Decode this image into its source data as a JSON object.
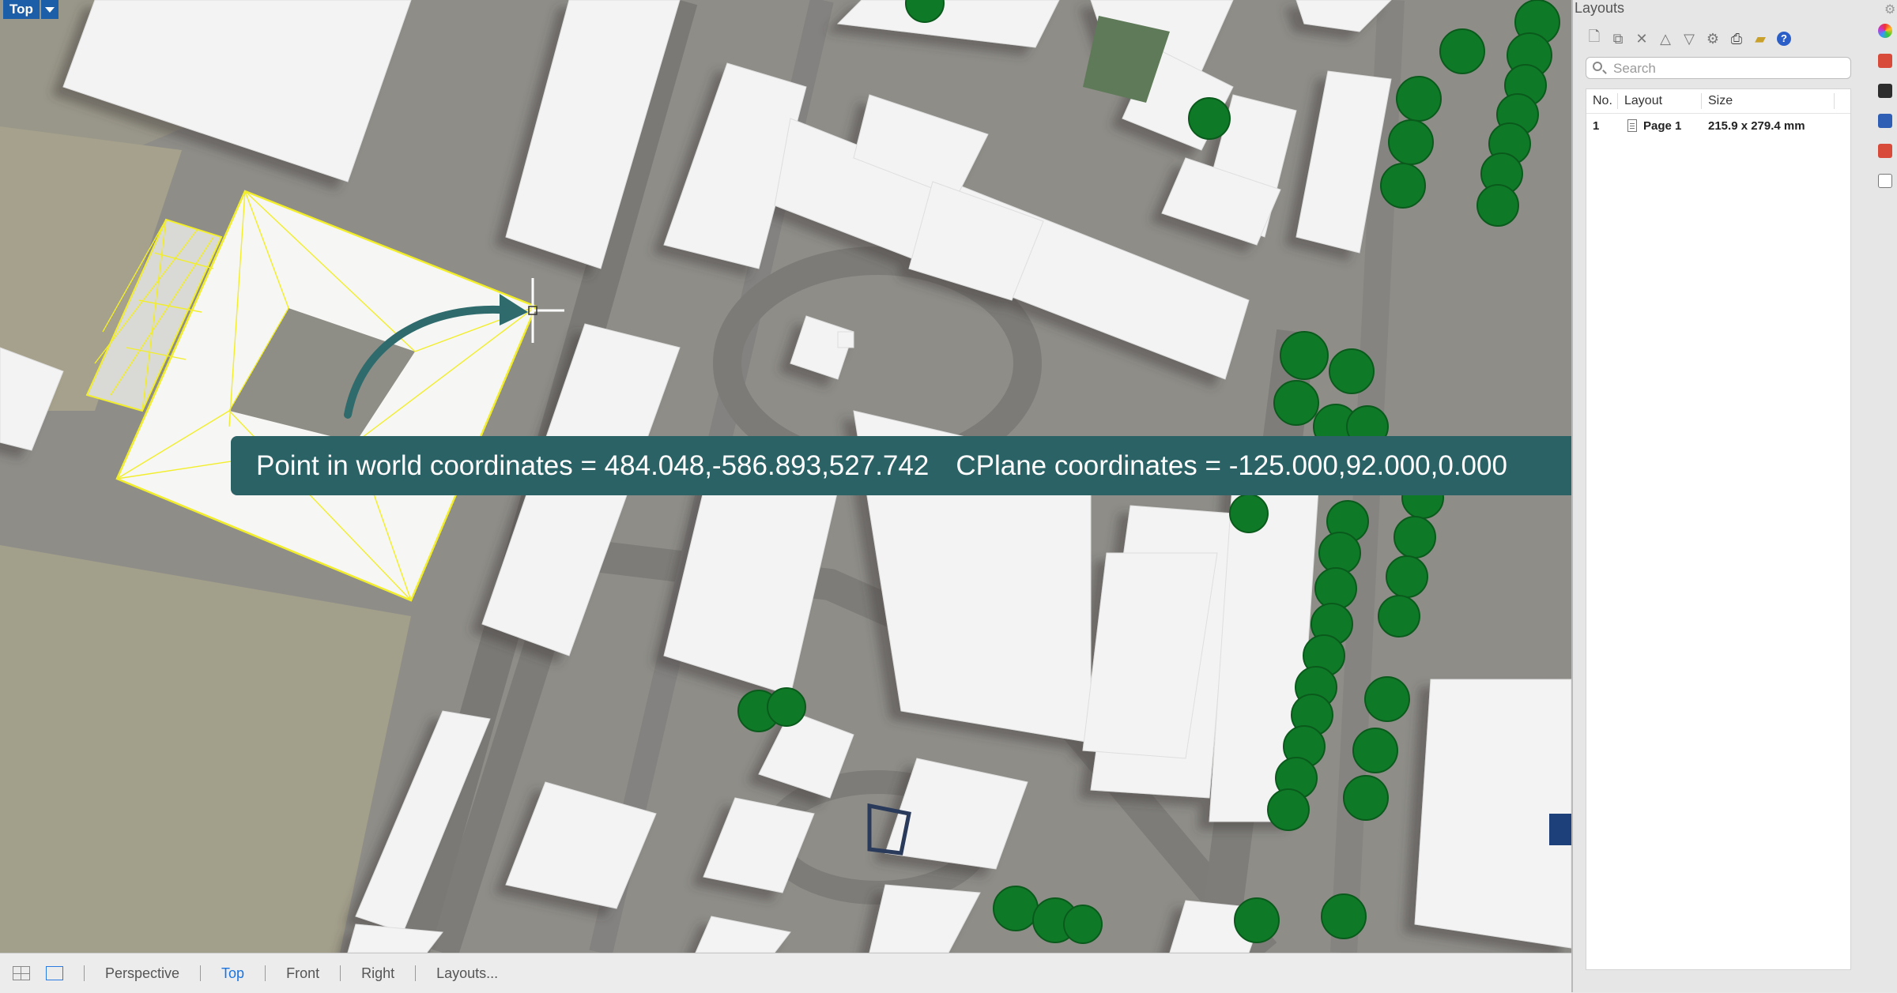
{
  "viewport": {
    "label": "Top",
    "tooltip_world_prefix": "Point in world coordinates = ",
    "tooltip_world_value": "484.048,-586.893,527.742",
    "tooltip_cplane_prefix": "CPlane coordinates = ",
    "tooltip_cplane_value": "-125.000,92.000,0.000"
  },
  "tabs": {
    "items": [
      "Perspective",
      "Top",
      "Front",
      "Right",
      "Layouts..."
    ],
    "active": "Top"
  },
  "panel": {
    "title": "Layouts",
    "search_placeholder": "Search",
    "columns": [
      "No.",
      "Layout",
      "Size"
    ],
    "rows": [
      {
        "no": "1",
        "layout": "Page 1",
        "size": "215.9 x 279.4 mm"
      }
    ]
  },
  "icons": {
    "toolbar": [
      "new-layout-icon",
      "copy-layout-icon",
      "delete-layout-icon",
      "move-up-icon",
      "move-down-icon",
      "properties-gear-icon",
      "print-icon",
      "open-folder-icon",
      "help-icon"
    ],
    "side_strip": [
      "color-wheel-icon",
      "layers-icon",
      "display-icon",
      "named-views-icon",
      "layers-stack-icon",
      "page-icon"
    ]
  },
  "colors": {
    "label_blue": "#1c5ea8",
    "tooltip_bg": "#2b6266",
    "active_tab": "#1a74e0",
    "selection_yellow": "#f2ee2a",
    "tree_green": "#0e7a28"
  }
}
